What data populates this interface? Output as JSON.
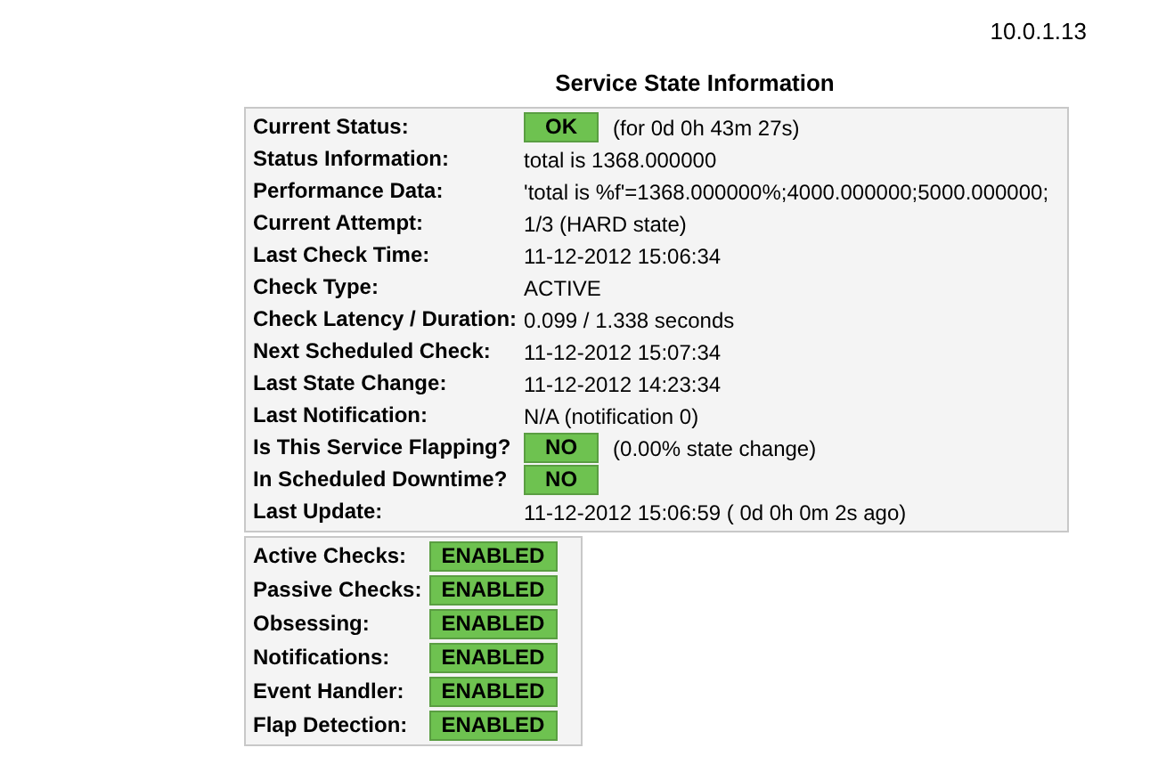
{
  "host": "10.0.1.13",
  "title": "Service State Information",
  "state_rows": [
    {
      "label": "Current Status:",
      "kind": "badge",
      "badge": "OK",
      "note": "(for 0d 0h 43m 27s)"
    },
    {
      "label": "Status Information:",
      "kind": "text",
      "value": "total is 1368.000000"
    },
    {
      "label": "Performance Data:",
      "kind": "text",
      "value": "'total is %f'=1368.000000%;4000.000000;5000.000000;"
    },
    {
      "label": "Current Attempt:",
      "kind": "text",
      "value": "1/3  (HARD state)"
    },
    {
      "label": "Last Check Time:",
      "kind": "text",
      "value": "11-12-2012 15:06:34"
    },
    {
      "label": "Check Type:",
      "kind": "text",
      "value": "ACTIVE"
    },
    {
      "label": "Check Latency / Duration:",
      "kind": "text",
      "value": "0.099 / 1.338 seconds"
    },
    {
      "label": "Next Scheduled Check:",
      "kind": "text",
      "value": "11-12-2012 15:07:34"
    },
    {
      "label": "Last State Change:",
      "kind": "text",
      "value": "11-12-2012 14:23:34"
    },
    {
      "label": "Last Notification:",
      "kind": "text",
      "value": "N/A (notification 0)"
    },
    {
      "label": "Is This Service Flapping?",
      "kind": "badge",
      "badge": "NO",
      "note": "(0.00% state change)"
    },
    {
      "label": "In Scheduled Downtime?",
      "kind": "badge",
      "badge": "NO"
    },
    {
      "label": "Last Update:",
      "kind": "text",
      "value": "11-12-2012 15:06:59  ( 0d 0h 0m 2s ago)"
    }
  ],
  "feature_rows": [
    {
      "label": "Active Checks:",
      "badge": "ENABLED"
    },
    {
      "label": "Passive Checks:",
      "badge": "ENABLED"
    },
    {
      "label": "Obsessing:",
      "badge": "ENABLED"
    },
    {
      "label": "Notifications:",
      "badge": "ENABLED"
    },
    {
      "label": "Event Handler:",
      "badge": "ENABLED"
    },
    {
      "label": "Flap Detection:",
      "badge": "ENABLED"
    }
  ]
}
